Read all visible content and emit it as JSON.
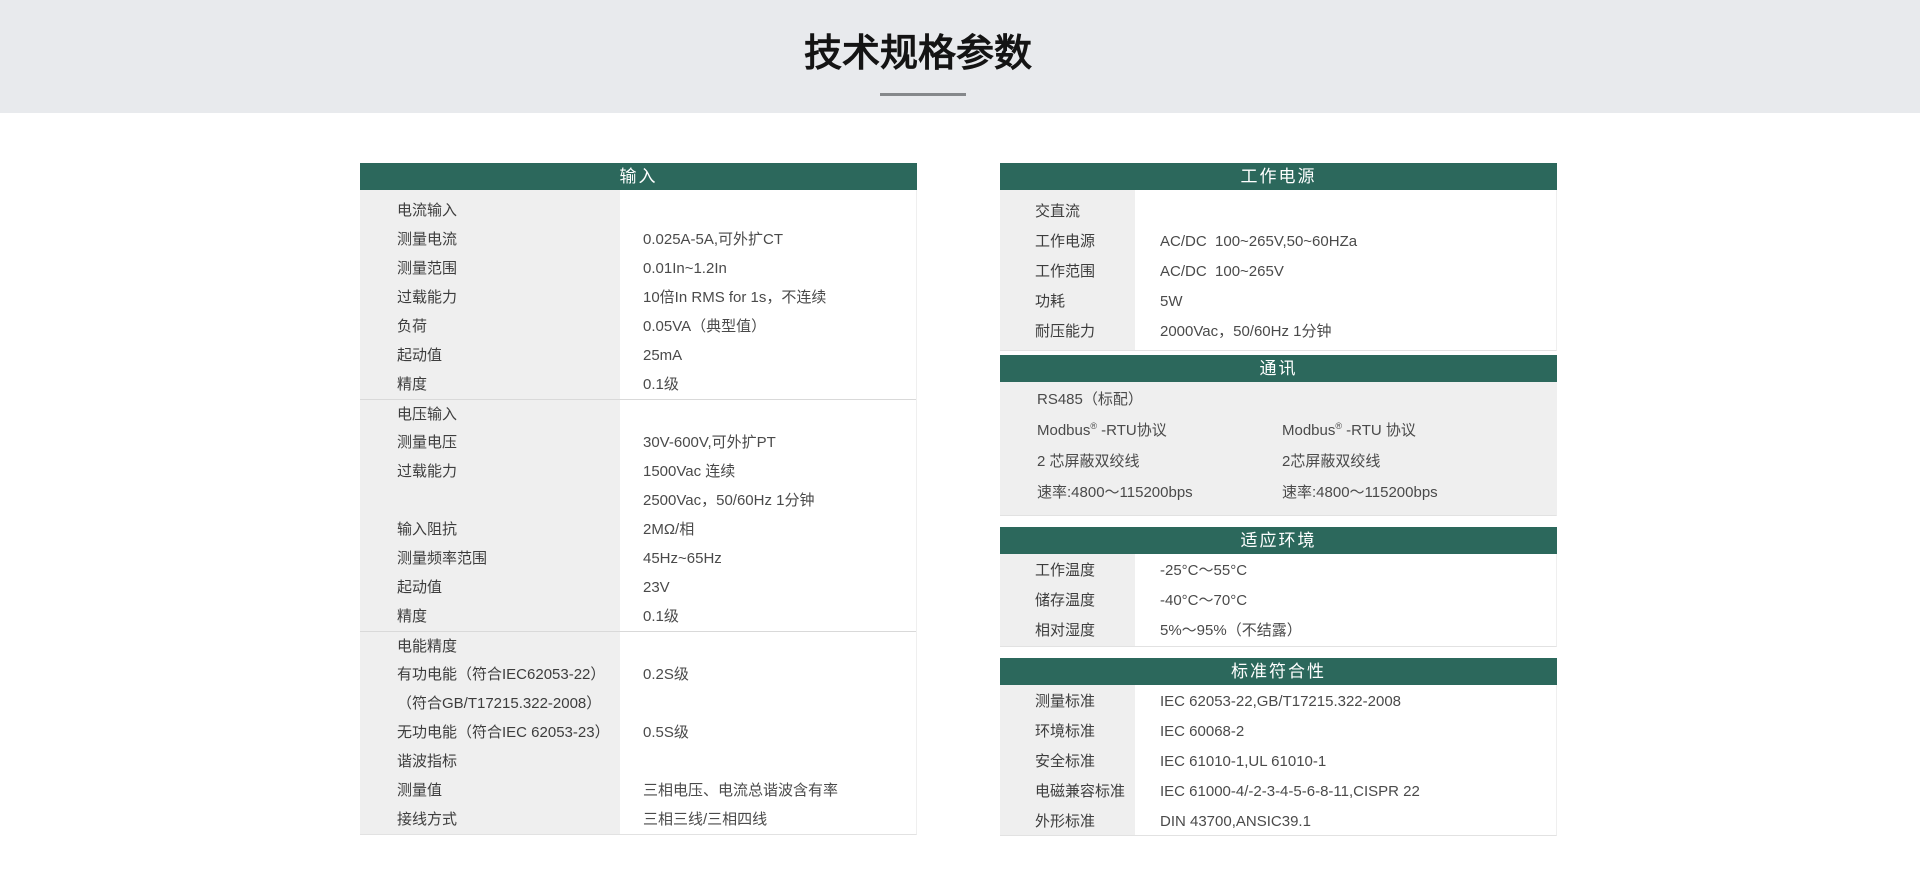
{
  "colors": {
    "accent_green": "#2c685c",
    "banner_gray": "#e8eaed",
    "label_column_gray": "#efefef"
  },
  "banner": {
    "title": "技术规格参数"
  },
  "tables": {
    "input": {
      "title": "输入",
      "rows": [
        {
          "label": "电流输入",
          "value": ""
        },
        {
          "label": "测量电流",
          "value": "0.025A-5A,可外扩CT"
        },
        {
          "label": "测量范围",
          "value": "0.01In~1.2In"
        },
        {
          "label": "过载能力",
          "value": "10倍In RMS for 1s，不连续"
        },
        {
          "label": "负荷",
          "value": "0.05VA（典型值）"
        },
        {
          "label": "起动值",
          "value": "25mA"
        },
        {
          "label": "精度",
          "value": "0.1级"
        },
        {
          "label": "电压输入",
          "value": "",
          "divider": true
        },
        {
          "label": "测量电压",
          "value": "30V-600V,可外扩PT"
        },
        {
          "label": "过载能力",
          "value": "1500Vac 连续"
        },
        {
          "label": "",
          "value": "2500Vac，50/60Hz 1分钟"
        },
        {
          "label": "输入阻抗",
          "value": "2MΩ/相"
        },
        {
          "label": "测量频率范围",
          "value": "45Hz~65Hz"
        },
        {
          "label": "起动值",
          "value": "23V"
        },
        {
          "label": "精度",
          "value": "0.1级"
        },
        {
          "label": "电能精度",
          "value": "",
          "divider": true
        },
        {
          "label": "有功电能（符合IEC62053-22）",
          "value": "0.2S级"
        },
        {
          "label": "（符合GB/T17215.322-2008）",
          "value": ""
        },
        {
          "label": "无功电能（符合IEC 62053-23）",
          "value": "0.5S级"
        },
        {
          "label": "谐波指标",
          "value": ""
        },
        {
          "label": "测量值",
          "value": "三相电压、电流总谐波含有率"
        },
        {
          "label": "接线方式",
          "value": "三相三线/三相四线"
        }
      ]
    },
    "power": {
      "title": "工作电源",
      "rows": [
        {
          "label": "交直流",
          "value": ""
        },
        {
          "label": "工作电源",
          "value": "AC/DC  100~265V,50~60HZa"
        },
        {
          "label": "工作范围",
          "value": "AC/DC  100~265V"
        },
        {
          "label": "功耗",
          "value": "5W"
        },
        {
          "label": "耐压能力",
          "value": "2000Vac，50/60Hz 1分钟"
        }
      ]
    },
    "comm": {
      "title": "通讯",
      "rows": [
        {
          "left": {
            "pre": "RS485（标配）"
          },
          "right": {
            "pre": ""
          }
        },
        {
          "left": {
            "pre": "Modbus",
            "sup": "®",
            "post": " -RTU协议"
          },
          "right": {
            "pre": "Modbus",
            "sup": "®",
            "post": " -RTU 协议"
          }
        },
        {
          "left": {
            "pre": "2 芯屏蔽双绞线"
          },
          "right": {
            "pre": "2芯屏蔽双绞线"
          }
        },
        {
          "left": {
            "pre": "速率:4800～115200bps"
          },
          "right": {
            "pre": "速率:4800～115200bps"
          }
        }
      ]
    },
    "env": {
      "title": "适应环境",
      "rows": [
        {
          "label": "工作温度",
          "value": "-25°C～55°C"
        },
        {
          "label": "储存温度",
          "value": "-40°C～70°C"
        },
        {
          "label": "相对湿度",
          "value": "5%～95%（不结露）"
        }
      ]
    },
    "standards": {
      "title": "标准符合性",
      "rows": [
        {
          "label": "测量标准",
          "value": "IEC 62053-22,GB/T17215.322-2008"
        },
        {
          "label": "环境标准",
          "value": "IEC 60068-2"
        },
        {
          "label": "安全标准",
          "value": "IEC 61010-1,UL 61010-1"
        },
        {
          "label": "电磁兼容标准",
          "value": "IEC 61000-4/-2-3-4-5-6-8-11,CISPR 22"
        },
        {
          "label": "外形标准",
          "value": "DIN 43700,ANSIC39.1"
        }
      ]
    }
  }
}
